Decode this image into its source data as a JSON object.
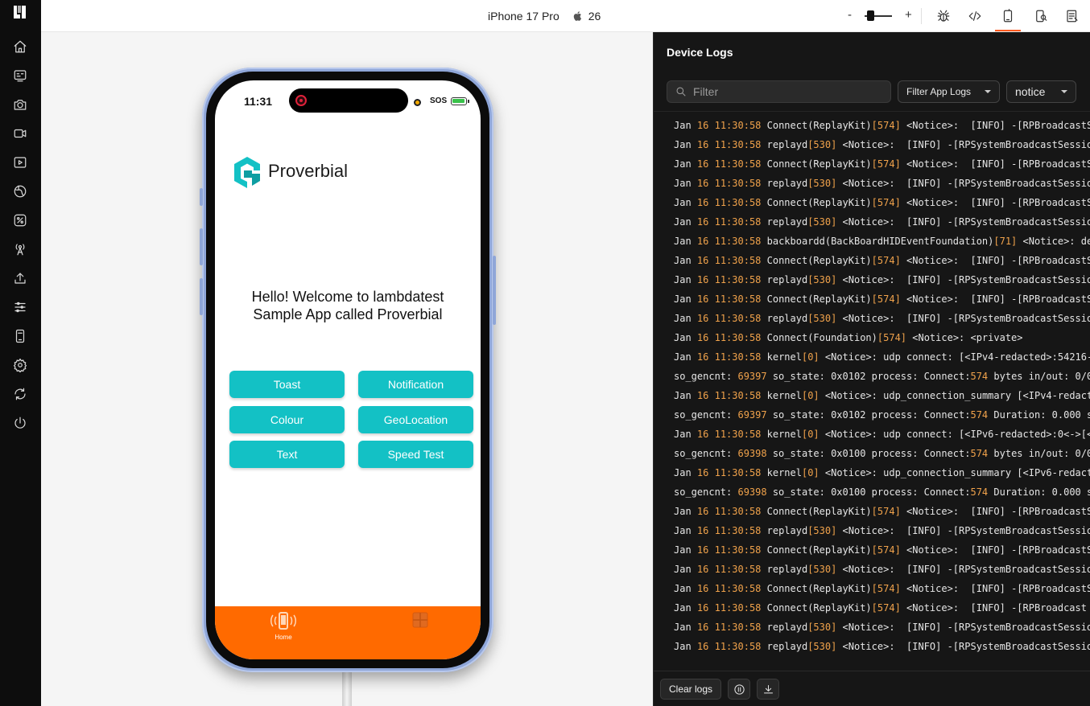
{
  "topbar": {
    "device_name": "iPhone 17 Pro",
    "os_version": "26",
    "zoom_minus": "-",
    "zoom_plus": "+",
    "zoom_level": 0.2
  },
  "app": {
    "status_time": "11:31",
    "status_sos": "SOS",
    "name": "Proverbial",
    "welcome": "Hello! Welcome to lambdatest Sample App called Proverbial",
    "buttons": [
      "Toast",
      "Notification",
      "Colour",
      "GeoLocation",
      "Text",
      "Speed Test"
    ],
    "tabs": [
      {
        "label": "Home"
      },
      {
        "label": ""
      }
    ],
    "brand_color": "#ff6a00",
    "button_color": "#13c1c5"
  },
  "logs": {
    "title": "Device Logs",
    "filter_placeholder": "Filter",
    "filter_app_logs_label": "Filter App Logs",
    "level_label": "notice",
    "clear_label": "Clear logs",
    "highlight_color": "#f0a24b",
    "lines": [
      [
        "Jan ",
        "16",
        " ",
        "11:30:58",
        " Connect(ReplayKit)",
        "[574]",
        " <Notice>:  [INFO] -[RPBroadcastS"
      ],
      [
        "Jan ",
        "16",
        " ",
        "11:30:58",
        " replayd",
        "[530]",
        " <Notice>:  [INFO] -[RPSystemBroadcastSessio"
      ],
      [
        "Jan ",
        "16",
        " ",
        "11:30:58",
        " Connect(ReplayKit)",
        "[574]",
        " <Notice>:  [INFO] -[RPBroadcastS"
      ],
      [
        "Jan ",
        "16",
        " ",
        "11:30:58",
        " replayd",
        "[530]",
        " <Notice>:  [INFO] -[RPSystemBroadcastSessio"
      ],
      [
        "Jan ",
        "16",
        " ",
        "11:30:58",
        " Connect(ReplayKit)",
        "[574]",
        " <Notice>:  [INFO] -[RPBroadcastS"
      ],
      [
        "Jan ",
        "16",
        " ",
        "11:30:58",
        " replayd",
        "[530]",
        " <Notice>:  [INFO] -[RPSystemBroadcastSessio"
      ],
      [
        "Jan ",
        "16",
        " ",
        "11:30:58",
        " backboardd(BackBoardHIDEventFoundation)",
        "[71]",
        " <Notice>: de"
      ],
      [
        "Jan ",
        "16",
        " ",
        "11:30:58",
        " Connect(ReplayKit)",
        "[574]",
        " <Notice>:  [INFO] -[RPBroadcastS"
      ],
      [
        "Jan ",
        "16",
        " ",
        "11:30:58",
        " replayd",
        "[530]",
        " <Notice>:  [INFO] -[RPSystemBroadcastSessio"
      ],
      [
        "Jan ",
        "16",
        " ",
        "11:30:58",
        " Connect(ReplayKit)",
        "[574]",
        " <Notice>:  [INFO] -[RPBroadcastS"
      ],
      [
        "Jan ",
        "16",
        " ",
        "11:30:58",
        " replayd",
        "[530]",
        " <Notice>:  [INFO] -[RPSystemBroadcastSessio"
      ],
      [
        "Jan ",
        "16",
        " ",
        "11:30:58",
        " Connect(Foundation)",
        "[574]",
        " <Notice>: <private>"
      ],
      [
        "Jan ",
        "16",
        " ",
        "11:30:58",
        " kernel",
        "[0]",
        " <Notice>: udp connect: [<IPv4-redacted>:54216-"
      ],
      [
        "so_gencnt: ",
        "69397",
        " so_state: 0x0102 process: Connect:",
        "574",
        " bytes in/out: 0/0",
        "",
        ""
      ],
      [
        "Jan ",
        "16",
        " ",
        "11:30:58",
        " kernel",
        "[0]",
        " <Notice>: udp_connection_summary [<IPv4-redact"
      ],
      [
        "so_gencnt: ",
        "69397",
        " so_state: 0x0102 process: Connect:",
        "574",
        " Duration: 0.000 s",
        "",
        ""
      ],
      [
        "Jan ",
        "16",
        " ",
        "11:30:58",
        " kernel",
        "[0]",
        " <Notice>: udp connect: [<IPv6-redacted>:0<->[<"
      ],
      [
        "so_gencnt: ",
        "69398",
        " so_state: 0x0100 process: Connect:",
        "574",
        " bytes in/out: 0/0",
        "",
        ""
      ],
      [
        "Jan ",
        "16",
        " ",
        "11:30:58",
        " kernel",
        "[0]",
        " <Notice>: udp_connection_summary [<IPv6-redact"
      ],
      [
        "so_gencnt: ",
        "69398",
        " so_state: 0x0100 process: Connect:",
        "574",
        " Duration: 0.000 s",
        "",
        ""
      ],
      [
        "Jan ",
        "16",
        " ",
        "11:30:58",
        " Connect(ReplayKit)",
        "[574]",
        " <Notice>:  [INFO] -[RPBroadcastS"
      ],
      [
        "Jan ",
        "16",
        " ",
        "11:30:58",
        " replayd",
        "[530]",
        " <Notice>:  [INFO] -[RPSystemBroadcastSessio"
      ],
      [
        "Jan ",
        "16",
        " ",
        "11:30:58",
        " Connect(ReplayKit)",
        "[574]",
        " <Notice>:  [INFO] -[RPBroadcastS"
      ],
      [
        "Jan ",
        "16",
        " ",
        "11:30:58",
        " replayd",
        "[530]",
        " <Notice>:  [INFO] -[RPSystemBroadcastSessio"
      ],
      [
        "Jan ",
        "16",
        " ",
        "11:30:58",
        " Connect(ReplayKit)",
        "[574]",
        " <Notice>:  [INFO] -[RPBroadcastS"
      ],
      [
        "Jan ",
        "16",
        " ",
        "11:30:58",
        " Connect(ReplayKit)",
        "[574]",
        " <Notice>:  [INFO] -[RPBroadcast"
      ],
      [
        "Jan ",
        "16",
        " ",
        "11:30:58",
        " replayd",
        "[530]",
        " <Notice>:  [INFO] -[RPSystemBroadcastSessio"
      ],
      [
        "Jan ",
        "16",
        " ",
        "11:30:58",
        " replayd",
        "[530]",
        " <Notice>:  [INFO] -[RPSystemBroadcastSessio"
      ]
    ]
  },
  "icons": {
    "sidebar": [
      "home-icon",
      "app-icon",
      "camera-icon",
      "video-icon",
      "playback-icon",
      "globe-icon",
      "percent-icon",
      "antenna-icon",
      "upload-icon",
      "sliders-icon",
      "device-icon",
      "settings-icon",
      "sync-icon",
      "power-icon"
    ],
    "toolbar": [
      "bug-icon",
      "code-icon",
      "device-logs-icon",
      "device-settings-icon",
      "report-icon"
    ]
  }
}
